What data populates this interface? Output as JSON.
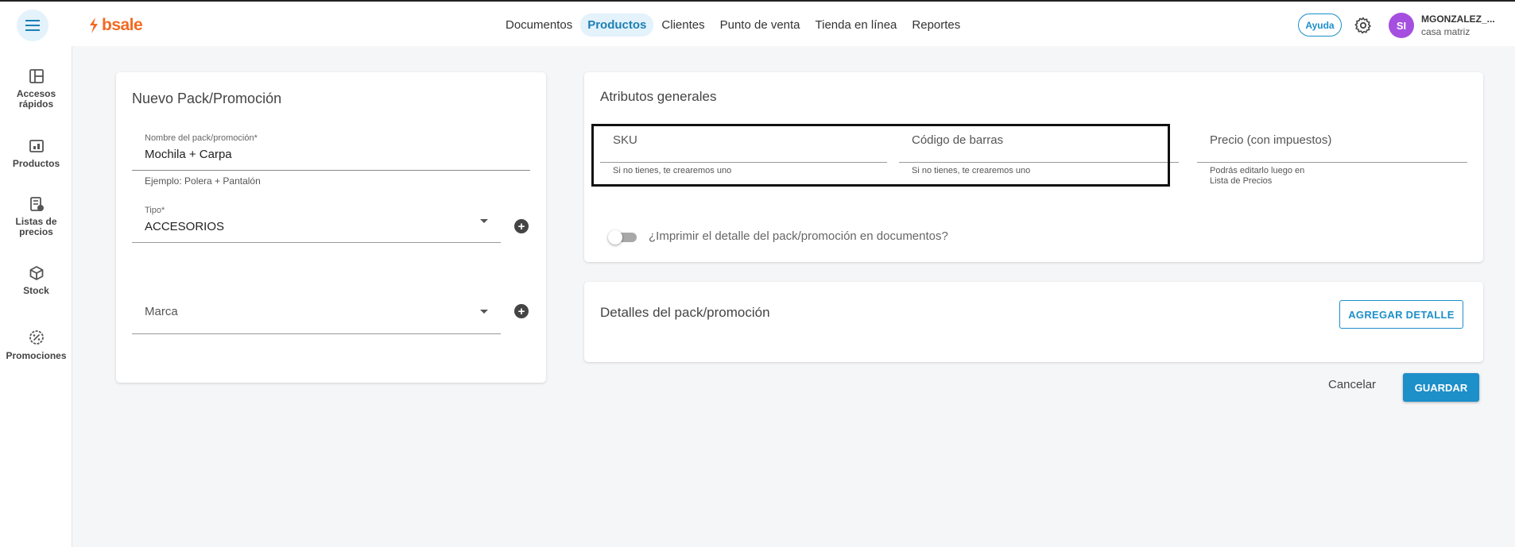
{
  "topbar": {
    "logo_text": "bsale",
    "nav": [
      "Documentos",
      "Productos",
      "Clientes",
      "Punto de venta",
      "Tienda en línea",
      "Reportes"
    ],
    "active_nav": "Productos",
    "help_label": "Ayuda",
    "avatar_initials": "SI",
    "user_name": "MGONZALEZ_...",
    "user_location": "casa matriz"
  },
  "sidebar": {
    "items": [
      {
        "label": "Accesos rápidos",
        "icon": "layout-icon"
      },
      {
        "label": "Productos",
        "icon": "products-icon"
      },
      {
        "label": "Listas de precios",
        "icon": "price-list-icon"
      },
      {
        "label": "Stock",
        "icon": "box-icon"
      },
      {
        "label": "Promociones",
        "icon": "promo-icon"
      }
    ]
  },
  "pack_form": {
    "title": "Nuevo Pack/Promoción",
    "name_label": "Nombre del pack/promoción*",
    "name_value": "Mochila + Carpa",
    "name_helper": "Ejemplo: Polera + Pantalón",
    "type_label": "Tipo*",
    "type_value": "ACCESORIOS",
    "brand_placeholder": "Marca"
  },
  "attributes": {
    "title": "Atributos generales",
    "sku_placeholder": "SKU",
    "sku_helper": "Si no tienes, te crearemos uno",
    "barcode_placeholder": "Código de barras",
    "barcode_helper": "Si no tienes, te crearemos uno",
    "price_placeholder": "Precio (con impuestos)",
    "price_helper_line1": "Podrás editarlo luego en",
    "price_helper_line2": "Lista de Precios",
    "print_toggle_label": "¿Imprimir el detalle del pack/promoción en documentos?"
  },
  "details": {
    "title": "Detalles del pack/promoción",
    "add_button": "AGREGAR DETALLE"
  },
  "actions": {
    "cancel": "Cancelar",
    "save": "GUARDAR"
  },
  "colors": {
    "brand_orange": "#f26a21",
    "accent_blue": "#1d8fc9",
    "avatar_purple": "#a54fe0"
  }
}
